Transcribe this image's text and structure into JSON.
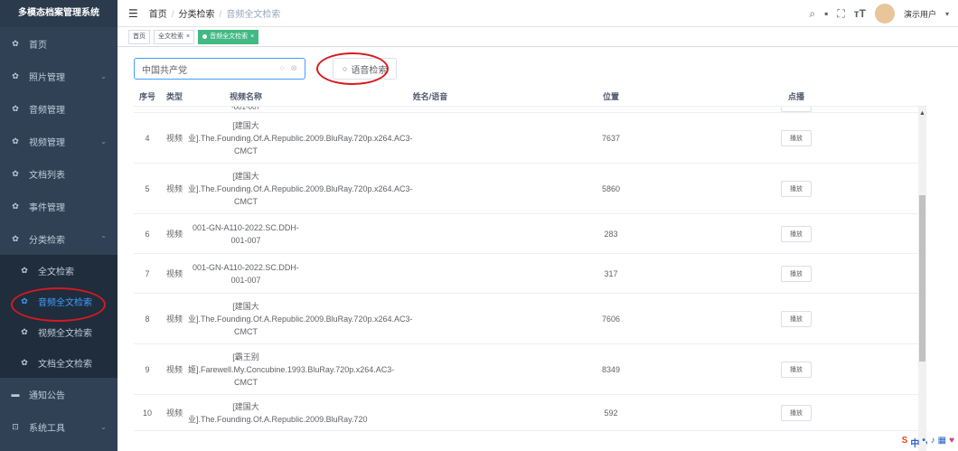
{
  "app": {
    "title": "多模态档案管理系统"
  },
  "sidebar": {
    "items": [
      {
        "label": "首页",
        "icon": "dashboard-icon"
      },
      {
        "label": "照片管理",
        "icon": "dashboard-icon",
        "arrow": "⌄"
      },
      {
        "label": "音频管理",
        "icon": "dashboard-icon"
      },
      {
        "label": "视频管理",
        "icon": "dashboard-icon",
        "arrow": "⌄"
      },
      {
        "label": "文档列表",
        "icon": "dashboard-icon"
      },
      {
        "label": "事件管理",
        "icon": "dashboard-icon"
      },
      {
        "label": "分类检索",
        "icon": "dashboard-icon",
        "arrow": "⌃"
      }
    ],
    "sub": [
      {
        "label": "全文检索"
      },
      {
        "label": "音频全文检索"
      },
      {
        "label": "视频全文检索"
      },
      {
        "label": "文档全文检索"
      }
    ],
    "bottom": [
      {
        "label": "通知公告"
      },
      {
        "label": "系统工具",
        "arrow": "⌄"
      }
    ]
  },
  "navbar": {
    "breadcrumb": [
      "首页",
      "分类检索",
      "音频全文检索"
    ],
    "separator": "/",
    "user": "演示用户"
  },
  "tags": [
    "首页",
    "全文检索",
    "音频全文检索"
  ],
  "search": {
    "value": "中国共产党",
    "button": "语音检索"
  },
  "table": {
    "headers": [
      "序号",
      "类型",
      "视频名称",
      "姓名/语音",
      "位置",
      "点播"
    ],
    "partial_top": "-001-007",
    "rows": [
      {
        "no": "4",
        "type": "视频",
        "name": "[建国大业].The.Founding.Of.A.Republic.2009.BluRay.720p.x264.AC3-CMCT",
        "speaker": "",
        "pos": "7637",
        "play": "播放"
      },
      {
        "no": "5",
        "type": "视频",
        "name": "[建国大业].The.Founding.Of.A.Republic.2009.BluRay.720p.x264.AC3-CMCT",
        "speaker": "",
        "pos": "5860",
        "play": "播放"
      },
      {
        "no": "6",
        "type": "视频",
        "name": "001-GN-A110-2022.SC.DDH-001-007",
        "speaker": "",
        "pos": "283",
        "play": "播放"
      },
      {
        "no": "7",
        "type": "视频",
        "name": "001-GN-A110-2022.SC.DDH-001-007",
        "speaker": "",
        "pos": "317",
        "play": "播放"
      },
      {
        "no": "8",
        "type": "视频",
        "name": "[建国大业].The.Founding.Of.A.Republic.2009.BluRay.720p.x264.AC3-CMCT",
        "speaker": "",
        "pos": "7606",
        "play": "播放"
      },
      {
        "no": "9",
        "type": "视频",
        "name": "[霸王别姬].Farewell.My.Concubine.1993.BluRay.720p.x264.AC3-CMCT",
        "speaker": "",
        "pos": "8349",
        "play": "播放"
      },
      {
        "no": "10",
        "type": "视频",
        "name": "[建国大业].The.Founding.Of.A.Republic.2009.BluRay.720",
        "speaker": "",
        "pos": "592",
        "play": "播放"
      }
    ]
  },
  "ime": {
    "label": "中"
  },
  "colors": {
    "sidebar": "#304156",
    "accent": "#409eff",
    "tag_active": "#42b983",
    "annotation": "#d71920"
  }
}
